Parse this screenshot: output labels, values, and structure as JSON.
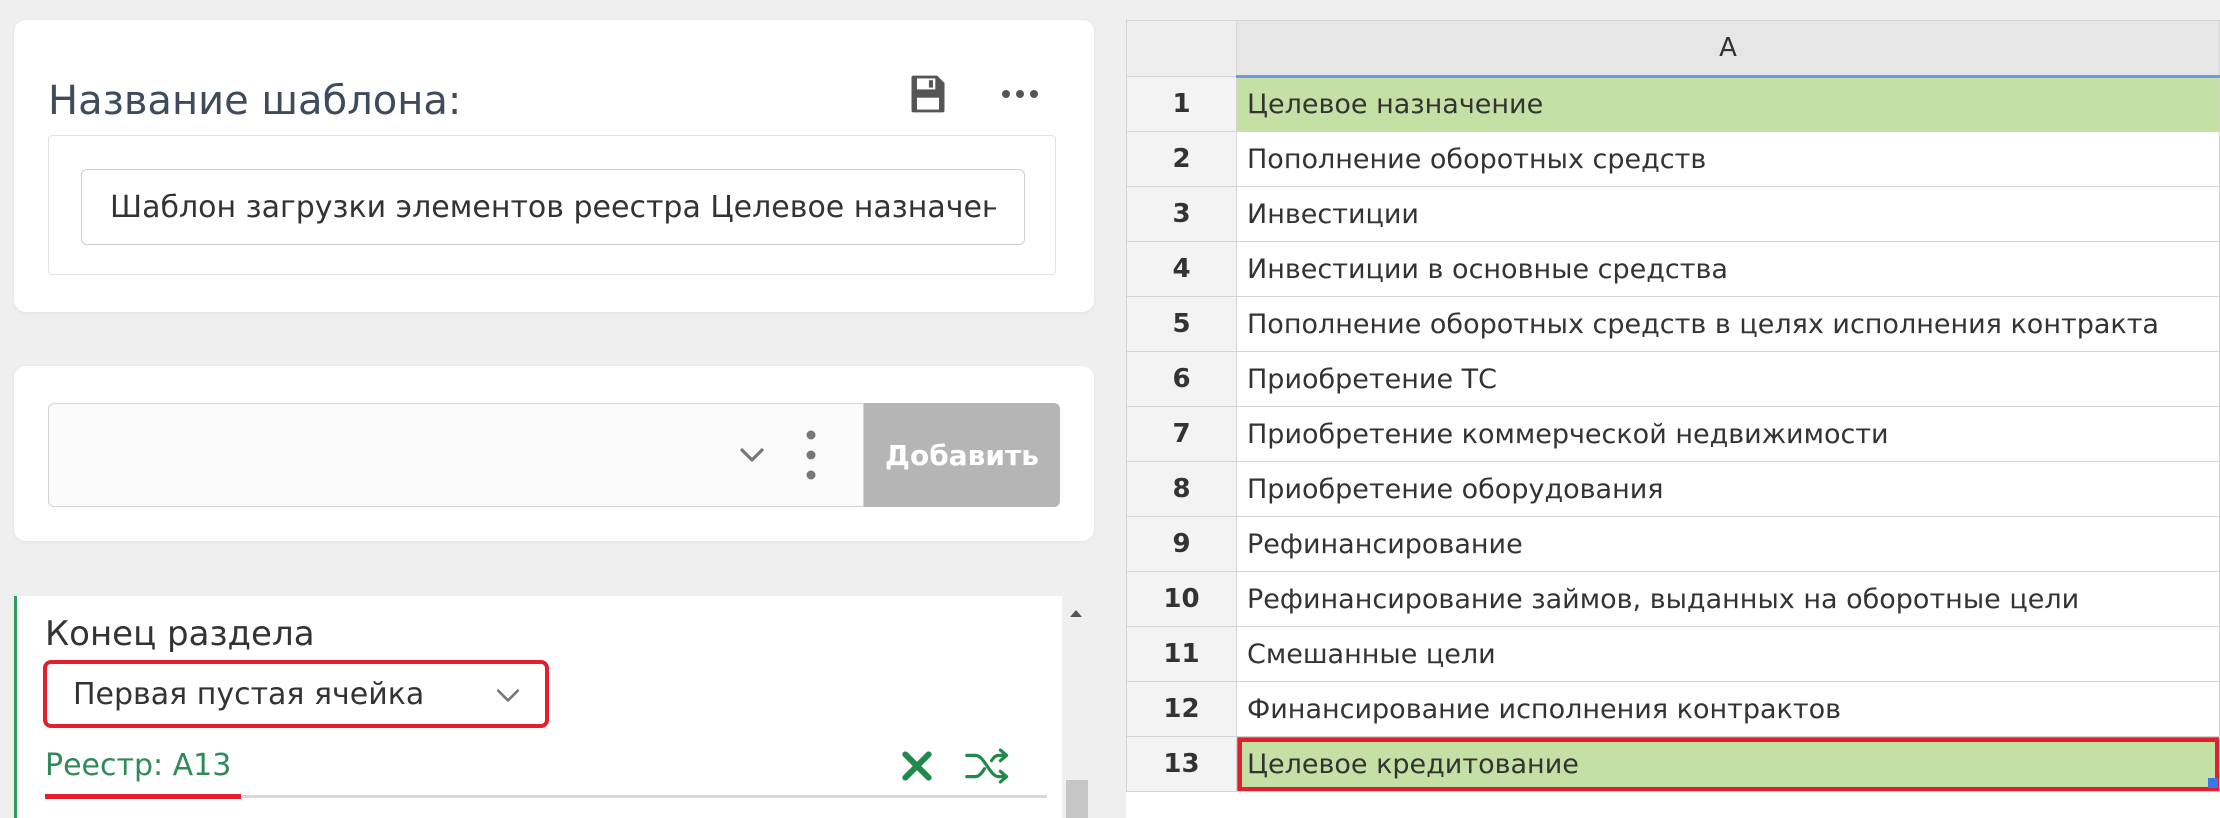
{
  "template_card": {
    "title": "Название шаблона:",
    "icons": {
      "save": "floppy-disk-icon",
      "more": "ellipsis-icon"
    },
    "name_input_value": "Шаблон загрузки элементов реестра Целевое назначение"
  },
  "add_card": {
    "select_value": "",
    "add_label": "Добавить"
  },
  "section": {
    "label": "Конец раздела",
    "dropdown_value": "Первая пустая ячейка",
    "registry_ref": "Реестр: A13",
    "icons": {
      "remove": "close-x-icon",
      "shuffle": "shuffle-icon"
    }
  },
  "sheet": {
    "column_header": "A",
    "rows": [
      {
        "num": "1",
        "text": "Целевое назначение",
        "highlight": true
      },
      {
        "num": "2",
        "text": "Пополнение оборотных средств",
        "highlight": false
      },
      {
        "num": "3",
        "text": "Инвестиции",
        "highlight": false
      },
      {
        "num": "4",
        "text": "Инвестиции в основные средства",
        "highlight": false
      },
      {
        "num": "5",
        "text": "Пополнение оборотных средств в целях исполнения контракта",
        "highlight": false
      },
      {
        "num": "6",
        "text": "Приобретение ТС",
        "highlight": false
      },
      {
        "num": "7",
        "text": "Приобретение коммерческой недвижимости",
        "highlight": false
      },
      {
        "num": "8",
        "text": "Приобретение оборудования",
        "highlight": false
      },
      {
        "num": "9",
        "text": "Рефинансирование",
        "highlight": false
      },
      {
        "num": "10",
        "text": "Рефинансирование займов, выданных на оборотные цели",
        "highlight": false
      },
      {
        "num": "11",
        "text": "Смешанные цели",
        "highlight": false
      },
      {
        "num": "12",
        "text": "Финансирование исполнения контрактов",
        "highlight": false
      },
      {
        "num": "13",
        "text": "Целевое кредитование",
        "highlight": true,
        "selected": true
      }
    ]
  },
  "colors": {
    "accent_green": "#2e8b57",
    "highlight_cell": "#c5e0a5",
    "annotation_red": "#e0202a",
    "selection_blue": "#3b78e7"
  }
}
